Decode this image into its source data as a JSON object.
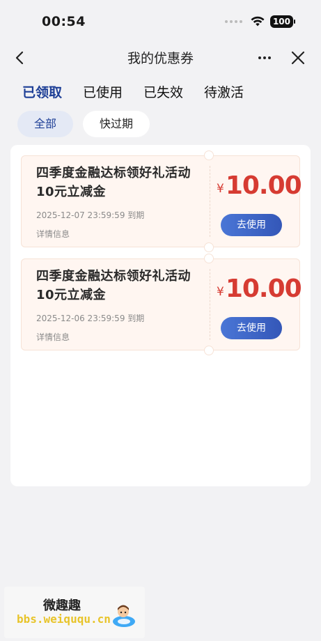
{
  "status_bar": {
    "time": "00:54",
    "battery": "100"
  },
  "nav": {
    "title": "我的优惠券"
  },
  "tabs": [
    {
      "label": "已领取",
      "active": true
    },
    {
      "label": "已使用",
      "active": false
    },
    {
      "label": "已失效",
      "active": false
    },
    {
      "label": "待激活",
      "active": false
    }
  ],
  "filters": [
    {
      "label": "全部",
      "active": true
    },
    {
      "label": "快过期",
      "active": false
    }
  ],
  "coupons": [
    {
      "title": "四季度金融达标领好礼活动10元立减金",
      "expiry": "2025-12-07 23:59:59 到期",
      "detail_label": "详情信息",
      "currency": "¥",
      "amount": "10.00",
      "button_label": "去使用"
    },
    {
      "title": "四季度金融达标领好礼活动10元立减金",
      "expiry": "2025-12-06 23:59:59 到期",
      "detail_label": "详情信息",
      "currency": "¥",
      "amount": "10.00",
      "button_label": "去使用"
    }
  ],
  "watermark": {
    "title": "微趣趣",
    "url": "bbs.weiququ.cn"
  },
  "colors": {
    "accent": "#1e3f96",
    "price": "#d63b32",
    "coupon_bg": "#fff6f1",
    "button": "#3457b8"
  },
  "icons": {
    "back": "chevron-left-icon",
    "more": "more-dots-icon",
    "close": "close-icon",
    "wifi": "wifi-icon",
    "battery": "battery-icon"
  }
}
